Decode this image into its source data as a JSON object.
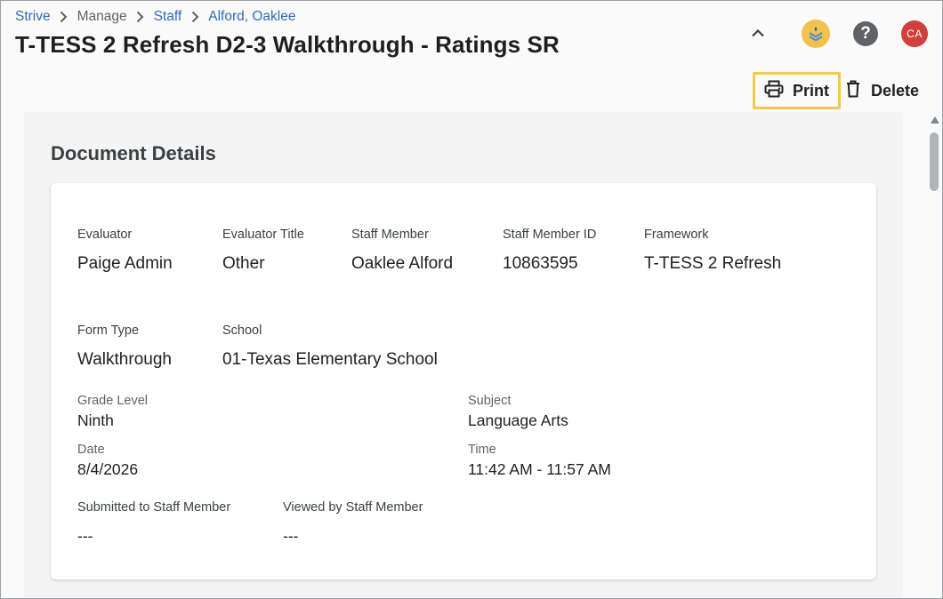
{
  "breadcrumb": {
    "items": [
      {
        "label": "Strive"
      },
      {
        "label": "Manage"
      },
      {
        "label": "Staff"
      },
      {
        "label": "Alford, Oaklee"
      }
    ]
  },
  "header": {
    "title": "T-TESS 2 Refresh D2-3 Walkthrough - Ratings SR",
    "help_glyph": "?",
    "avatar_initials": "CA",
    "icons": [
      "chevron-up-icon",
      "brand-logo-icon",
      "help-icon"
    ],
    "colors": {
      "avatar": "#d23f3f",
      "logo": "#f2c14e",
      "print_highlight": "#f2c94c",
      "link": "#2f6bb3"
    }
  },
  "actions": {
    "print_label": "Print",
    "delete_label": "Delete"
  },
  "details": {
    "section_title": "Document Details",
    "evaluator_label": "Evaluator",
    "evaluator_value": "Paige Admin",
    "evaluator_title_label": "Evaluator Title",
    "evaluator_title_value": "Other",
    "staff_member_label": "Staff Member",
    "staff_member_value": "Oaklee Alford",
    "staff_member_id_label": "Staff Member ID",
    "staff_member_id_value": "10863595",
    "framework_label": "Framework",
    "framework_value": "T-TESS 2 Refresh",
    "form_type_label": "Form Type",
    "form_type_value": "Walkthrough",
    "school_label": "School",
    "school_value": "01-Texas Elementary School",
    "grade_level_label": "Grade Level",
    "grade_level_value": "Ninth",
    "subject_label": "Subject",
    "subject_value": "Language Arts",
    "date_label": "Date",
    "date_value": "8/4/2026",
    "time_label": "Time",
    "time_value": "11:42 AM - 11:57 AM",
    "submitted_label": "Submitted to Staff Member",
    "submitted_value": "---",
    "viewed_label": "Viewed by Staff Member",
    "viewed_value": "---"
  }
}
